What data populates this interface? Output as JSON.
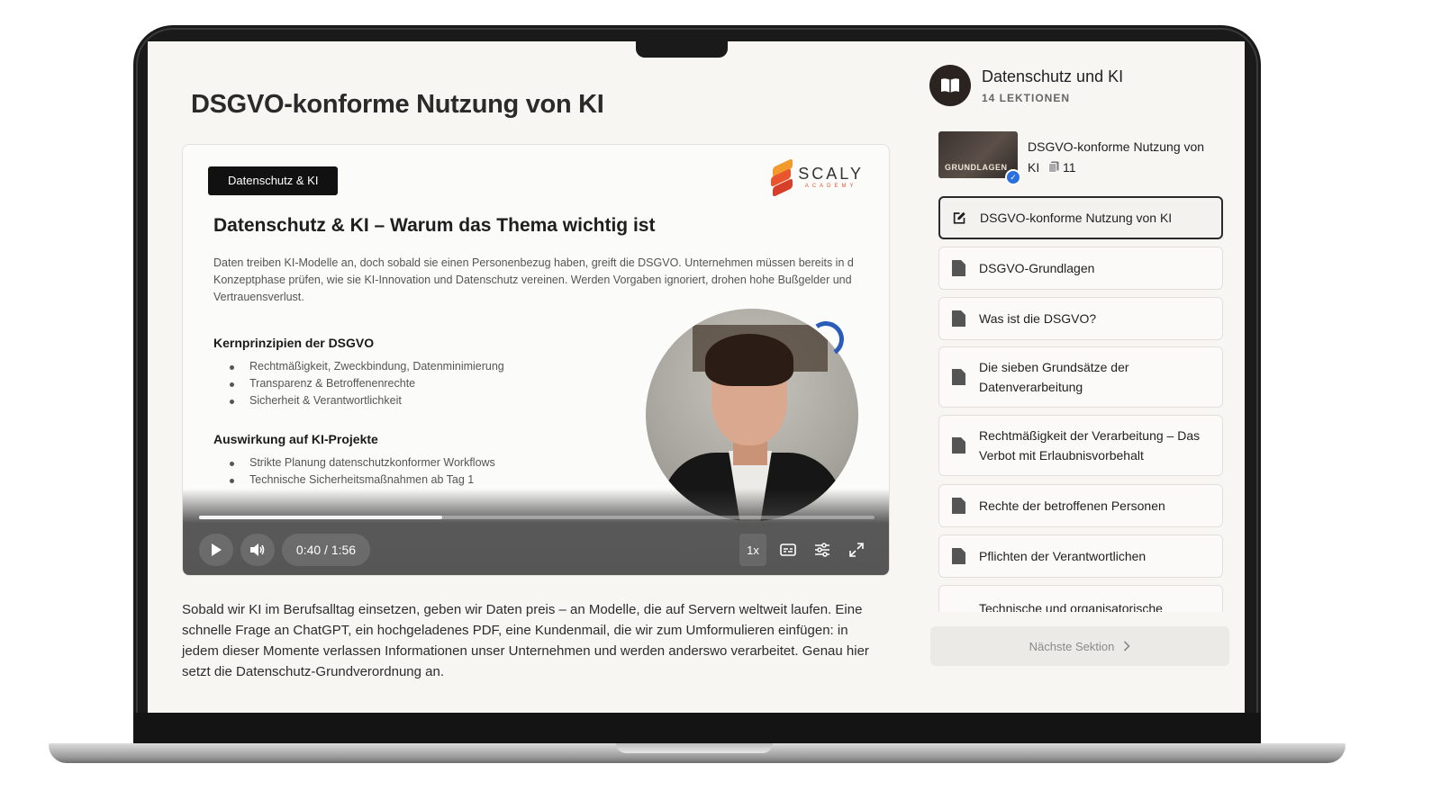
{
  "page": {
    "title": "DSGVO-konforme Nutzung von KI",
    "body_text": "Sobald wir KI im Berufsalltag einsetzen, geben wir Daten preis – an Modelle, die auf Servern weltweit laufen. Eine schnelle Frage an ChatGPT, ein hochgeladenes PDF, eine Kundenmail, die wir zum Umformulieren einfügen: in jedem dieser Momente verlassen Informationen unser Unternehmen und werden anderswo verarbeitet. Genau hier setzt die Datenschutz-Grundverordnung an."
  },
  "video": {
    "tag": "Datenschutz & KI",
    "logo_name": "SCALY",
    "logo_sub": "ACADEMY",
    "slide_heading": "Datenschutz & KI – Warum das Thema wichtig ist",
    "slide_intro": "Daten treiben KI-Modelle an, doch sobald sie einen Personenbezug haben, greift die DSGVO. Unternehmen müssen bereits in d Konzeptphase prüfen, wie sie KI-Innovation und Datenschutz vereinen. Werden Vorgaben ignoriert, drohen hohe Bußgelder und Vertrauensverlust.",
    "section1_title": "Kernprinzipien der DSGVO",
    "section1_items": [
      "Rechtmäßigkeit, Zweckbindung, Datenminimierung",
      "Transparenz & Betroffenenrechte",
      "Sicherheit & Verantwortlichkeit"
    ],
    "section2_title": "Auswirkung auf KI-Projekte",
    "section2_items": [
      "Strikte Planung datenschutzkonformer Workflows",
      "Technische Sicherheitsmaßnahmen ab Tag 1"
    ],
    "time": "0:40 / 1:56",
    "progress": 0.36,
    "speed": "1x"
  },
  "course": {
    "title": "Datenschutz und KI",
    "lesson_count": "14 LEKTIONEN"
  },
  "module": {
    "thumb_label": "GRUNDLAGEN",
    "title": "DSGVO-konforme Nutzung von KI",
    "count": "11"
  },
  "lessons": [
    {
      "label": "DSGVO-konforme Nutzung von KI"
    },
    {
      "label": "DSGVO-Grundlagen"
    },
    {
      "label": "Was ist die DSGVO?"
    },
    {
      "label": "Die sieben Grundsätze der Datenverarbeitung"
    },
    {
      "label": "Rechtmäßigkeit der Verarbeitung – Das Verbot mit Erlaubnisvorbehalt"
    },
    {
      "label": "Rechte der betroffenen Personen"
    },
    {
      "label": "Pflichten der Verantwortlichen"
    },
    {
      "label": "Technische und organisatorische"
    }
  ],
  "next_button": "Nächste Sektion",
  "colors": {
    "accent_blue": "#2a6fe0",
    "logo_orange": "#e8552f",
    "screen_bg": "#f8f6f3"
  }
}
